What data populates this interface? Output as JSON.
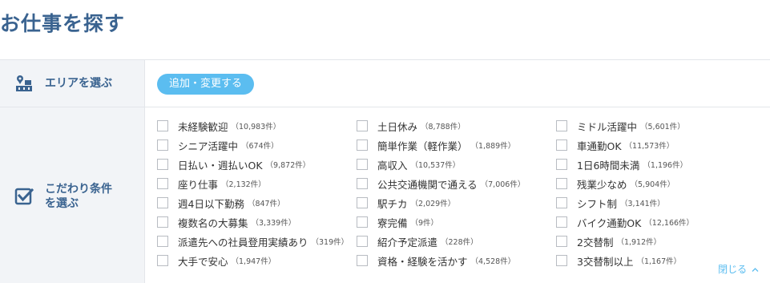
{
  "title": "お仕事を探す",
  "area_row": {
    "label": "エリアを選ぶ",
    "icon": "map-pin-icon",
    "add_button": "追加・変更する"
  },
  "condition_row": {
    "label_line1": "こだわり条件",
    "label_line2": "を選ぶ",
    "icon": "checkbox-checked-icon",
    "close_label": "閉じる",
    "close_icon": "chevron-up-icon",
    "columns": [
      [
        {
          "name": "未経験歓迎",
          "count": "（10,983件）"
        },
        {
          "name": "シニア活躍中",
          "count": "（674件）"
        },
        {
          "name": "日払い・週払いOK",
          "count": "（9,872件）"
        },
        {
          "name": "座り仕事",
          "count": "（2,132件）"
        },
        {
          "name": "週4日以下勤務",
          "count": "（847件）"
        },
        {
          "name": "複数名の大募集",
          "count": "（3,339件）"
        },
        {
          "name": "派遣先への社員登用実績あり",
          "count": "（319件）"
        },
        {
          "name": "大手で安心",
          "count": "（1,947件）"
        }
      ],
      [
        {
          "name": "土日休み",
          "count": "（8,788件）"
        },
        {
          "name": "簡単作業（軽作業）",
          "count": "（1,889件）"
        },
        {
          "name": "高収入",
          "count": "（10,537件）"
        },
        {
          "name": "公共交通機関で通える",
          "count": "（7,006件）"
        },
        {
          "name": "駅チカ",
          "count": "（2,029件）"
        },
        {
          "name": "寮完備",
          "count": "（9件）"
        },
        {
          "name": "紹介予定派遣",
          "count": "（228件）"
        },
        {
          "name": "資格・経験を活かす",
          "count": "（4,528件）"
        }
      ],
      [
        {
          "name": "ミドル活躍中",
          "count": "（5,601件）"
        },
        {
          "name": "車通勤OK",
          "count": "（11,573件）"
        },
        {
          "name": "1日6時間未満",
          "count": "（1,196件）"
        },
        {
          "name": "残業少なめ",
          "count": "（5,904件）"
        },
        {
          "name": "シフト制",
          "count": "（3,141件）"
        },
        {
          "name": "バイク通勤OK",
          "count": "（12,166件）"
        },
        {
          "name": "2交替制",
          "count": "（1,912件）"
        },
        {
          "name": "3交替制以上",
          "count": "（1,167件）"
        }
      ]
    ]
  },
  "colors": {
    "heading": "#3a6390",
    "accent": "#5bbdf0",
    "label_bg": "#f2f4f7",
    "border": "#e3e6ea"
  }
}
